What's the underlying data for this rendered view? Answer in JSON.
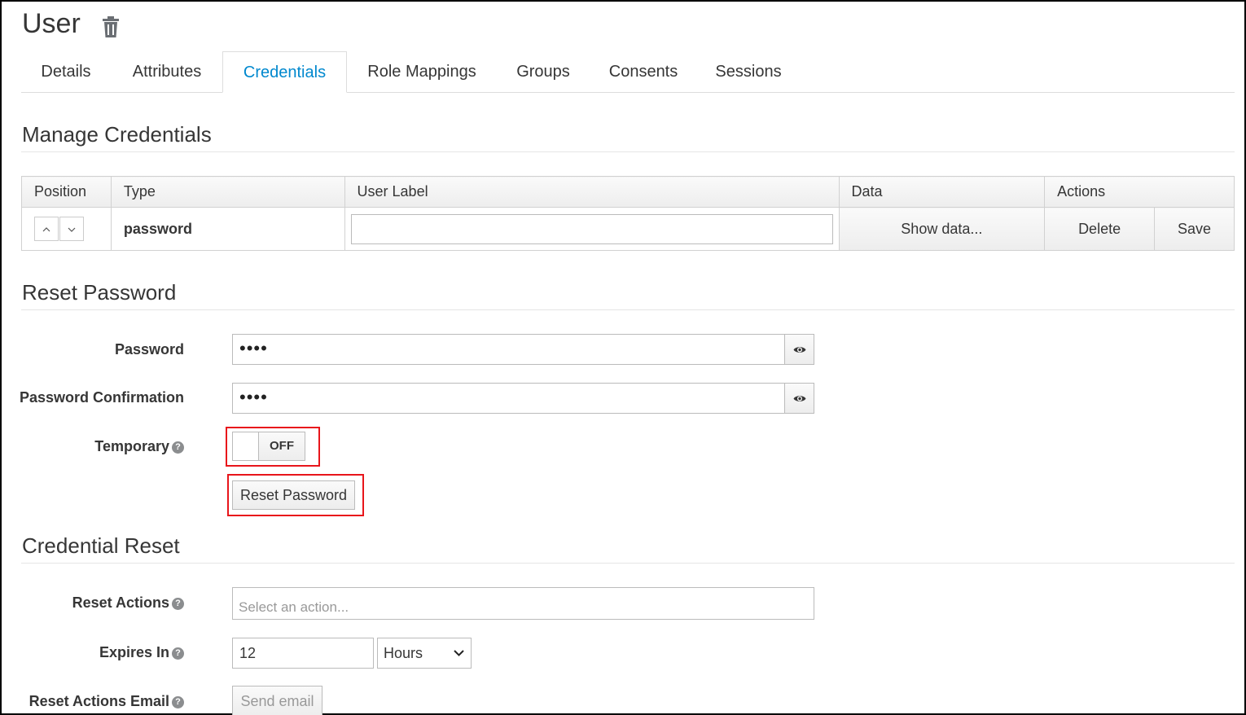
{
  "header": {
    "title": "User"
  },
  "tabs": [
    {
      "label": "Details"
    },
    {
      "label": "Attributes"
    },
    {
      "label": "Credentials",
      "active": true
    },
    {
      "label": "Role Mappings"
    },
    {
      "label": "Groups"
    },
    {
      "label": "Consents"
    },
    {
      "label": "Sessions"
    }
  ],
  "manage": {
    "title": "Manage Credentials",
    "columns": [
      "Position",
      "Type",
      "User Label",
      "Data",
      "Actions"
    ],
    "row": {
      "type": "password",
      "user_label": "",
      "data_button": "Show data...",
      "delete_button": "Delete",
      "save_button": "Save"
    }
  },
  "reset_password": {
    "title": "Reset Password",
    "password_label": "Password",
    "password_value": "••••",
    "confirm_label": "Password Confirmation",
    "confirm_value": "••••",
    "temporary_label": "Temporary",
    "temporary_state": "OFF",
    "button": "Reset Password"
  },
  "credential_reset": {
    "title": "Credential Reset",
    "actions_label": "Reset Actions",
    "actions_placeholder": "Select an action...",
    "expires_label": "Expires In",
    "expires_value": "12",
    "expires_unit": "Hours",
    "email_label": "Reset Actions Email",
    "email_button": "Send email"
  },
  "colors": {
    "accent": "#0088ce",
    "highlight": "#e8151b"
  }
}
